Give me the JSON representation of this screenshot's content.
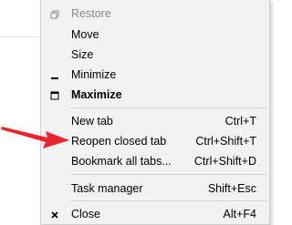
{
  "menu": {
    "items": [
      {
        "label": "Restore",
        "shortcut": "",
        "icon": "restore-icon",
        "disabled": true,
        "bold": false
      },
      {
        "label": "Move",
        "shortcut": "",
        "icon": "",
        "disabled": false,
        "bold": false
      },
      {
        "label": "Size",
        "shortcut": "",
        "icon": "",
        "disabled": false,
        "bold": false
      },
      {
        "label": "Minimize",
        "shortcut": "",
        "icon": "minimize-icon",
        "disabled": false,
        "bold": false
      },
      {
        "label": "Maximize",
        "shortcut": "",
        "icon": "maximize-icon",
        "disabled": false,
        "bold": true
      },
      {
        "label": "New tab",
        "shortcut": "Ctrl+T",
        "icon": "",
        "disabled": false,
        "bold": false
      },
      {
        "label": "Reopen closed tab",
        "shortcut": "Ctrl+Shift+T",
        "icon": "",
        "disabled": false,
        "bold": false
      },
      {
        "label": "Bookmark all tabs...",
        "shortcut": "Ctrl+Shift+D",
        "icon": "",
        "disabled": false,
        "bold": false
      },
      {
        "label": "Task manager",
        "shortcut": "Shift+Esc",
        "icon": "",
        "disabled": false,
        "bold": false
      },
      {
        "label": "Close",
        "shortcut": "Alt+F4",
        "icon": "close-icon",
        "disabled": false,
        "bold": false
      }
    ]
  },
  "colors": {
    "menu_background": "#f2f2f2",
    "annotation_arrow": "#e8242c",
    "disabled_text": "#8a8a8a"
  }
}
